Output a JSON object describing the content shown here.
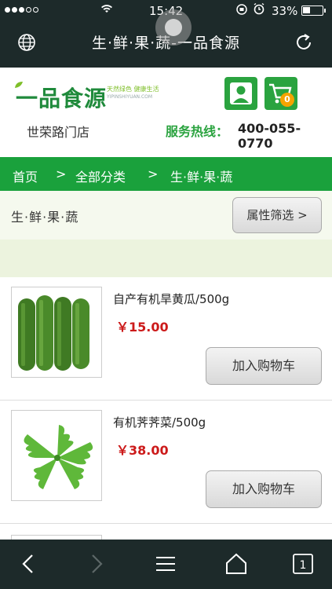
{
  "status_bar": {
    "time": "15:42",
    "battery": "33%",
    "signal_icon": "signal-dots-icon",
    "wifi_icon": "wifi-icon",
    "alarm_icon": "alarm-icon"
  },
  "browser": {
    "page_title": "生·鲜·果·蔬-一品食源",
    "left_icon": "globe-icon",
    "right_icon": "refresh-icon"
  },
  "header": {
    "logo_text": "一品食源",
    "logo_slogan": "天然绿色 健康生活",
    "logo_domain": "YIPINSHIYUAN.COM",
    "cart_count": "0",
    "store_name": "世荣路门店",
    "hotline_label": "服务热线：",
    "hotline_number": "400-055-0770"
  },
  "breadcrumb": {
    "home": "首页",
    "separator": ">",
    "all_categories": "全部分类",
    "current": "生·鲜·果·蔬"
  },
  "filter": {
    "category_label": "生·鲜·果·蔬",
    "filter_button": "属性筛选 >"
  },
  "products": [
    {
      "name": "自产有机旱黄瓜/500g",
      "price": "￥15.00",
      "button": "加入购物车"
    },
    {
      "name": "有机荠荠菜/500g",
      "price": "￥38.00",
      "button": "加入购物车"
    }
  ],
  "colors": {
    "brand_green": "#1aa13c",
    "price_red": "#cc1a1a",
    "dark_bar": "#1d2a2a"
  }
}
